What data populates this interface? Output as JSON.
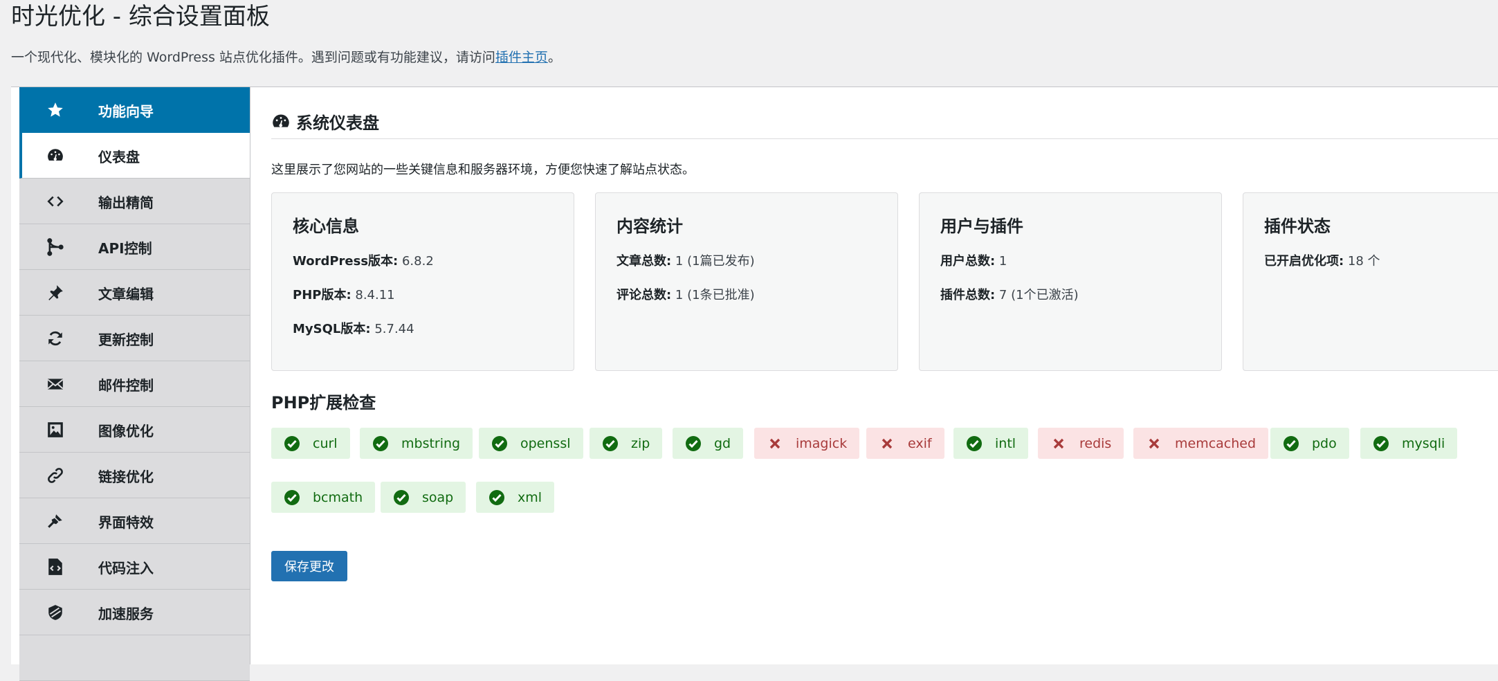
{
  "page": {
    "title": "时光优化 - 综合设置面板",
    "description_prefix": "一个现代化、模块化的 WordPress 站点优化插件。遇到问题或有功能建议，请访问",
    "description_link": "插件主页",
    "description_suffix": "。"
  },
  "sidebar": {
    "items": [
      {
        "label": "功能向导",
        "icon": "star-icon"
      },
      {
        "label": "仪表盘",
        "icon": "dashboard-icon"
      },
      {
        "label": "输出精简",
        "icon": "code-icon"
      },
      {
        "label": "API控制",
        "icon": "api-icon"
      },
      {
        "label": "文章编辑",
        "icon": "pin-icon"
      },
      {
        "label": "更新控制",
        "icon": "update-icon"
      },
      {
        "label": "邮件控制",
        "icon": "email-icon"
      },
      {
        "label": "图像优化",
        "icon": "image-icon"
      },
      {
        "label": "链接优化",
        "icon": "link-icon"
      },
      {
        "label": "界面特效",
        "icon": "brush-icon"
      },
      {
        "label": "代码注入",
        "icon": "code-file-icon"
      },
      {
        "label": "加速服务",
        "icon": "shield-icon"
      }
    ]
  },
  "dashboard": {
    "title": "系统仪表盘",
    "intro": "这里展示了您网站的一些关键信息和服务器环境，方便您快速了解站点状态。",
    "cards": [
      {
        "title": "核心信息",
        "rows": [
          {
            "label": "WordPress版本:",
            "value": " 6.8.2"
          },
          {
            "label": "PHP版本:",
            "value": " 8.4.11"
          },
          {
            "label": "MySQL版本:",
            "value": " 5.7.44"
          }
        ]
      },
      {
        "title": "内容统计",
        "rows": [
          {
            "label": "文章总数:",
            "value": " 1 (1篇已发布)"
          },
          {
            "label": "评论总数:",
            "value": " 1 (1条已批准)"
          }
        ]
      },
      {
        "title": "用户与插件",
        "rows": [
          {
            "label": "用户总数:",
            "value": " 1"
          },
          {
            "label": "插件总数:",
            "value": " 7 (1个已激活)"
          }
        ]
      },
      {
        "title": "插件状态",
        "rows": [
          {
            "label": "已开启优化项:",
            "value": " 18 个"
          }
        ]
      }
    ],
    "extensions_title": "PHP扩展检查",
    "extensions": [
      {
        "name": "curl",
        "status": "ok"
      },
      {
        "name": "mbstring",
        "status": "ok"
      },
      {
        "name": "openssl",
        "status": "ok"
      },
      {
        "name": "zip",
        "status": "ok"
      },
      {
        "name": "gd",
        "status": "ok"
      },
      {
        "name": "imagick",
        "status": "missing"
      },
      {
        "name": "exif",
        "status": "missing"
      },
      {
        "name": "intl",
        "status": "ok"
      },
      {
        "name": "redis",
        "status": "missing"
      },
      {
        "name": "memcached",
        "status": "missing"
      },
      {
        "name": "pdo",
        "status": "ok"
      },
      {
        "name": "mysqli",
        "status": "ok"
      },
      {
        "name": "bcmath",
        "status": "ok"
      },
      {
        "name": "soap",
        "status": "ok"
      },
      {
        "name": "xml",
        "status": "ok"
      }
    ],
    "save_label": "保存更改"
  },
  "colors": {
    "accent": "#0073aa",
    "button": "#2271b1",
    "ok_bg": "#e3f5e3",
    "ok_fg": "#116b11",
    "bad_bg": "#fbe3e4",
    "bad_fg": "#a83b3b"
  }
}
